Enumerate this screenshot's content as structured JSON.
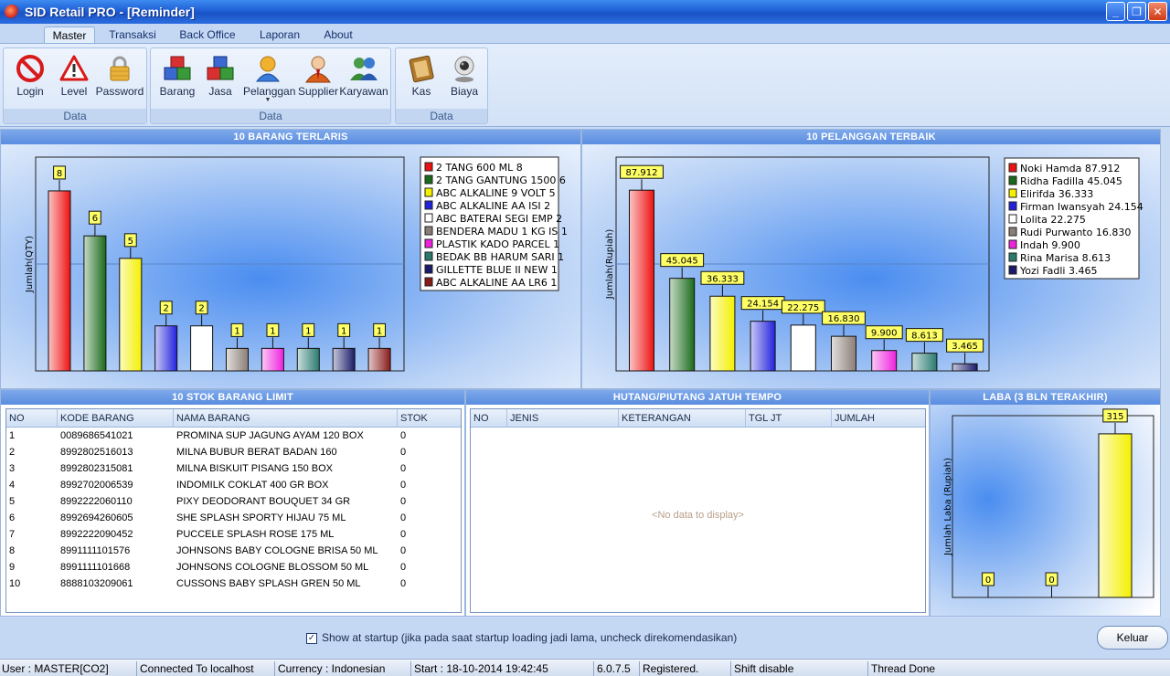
{
  "window": {
    "title": "SID Retail PRO - [Reminder]"
  },
  "ribbon": {
    "tabs": [
      "Master",
      "Transaksi",
      "Back Office",
      "Laporan",
      "About"
    ],
    "active_tab": "Master",
    "groups": [
      {
        "label": "Data",
        "buttons": [
          {
            "label": "Login",
            "icon": "no-entry-icon"
          },
          {
            "label": "Level",
            "icon": "warning-icon"
          },
          {
            "label": "Password",
            "icon": "padlock-icon"
          }
        ]
      },
      {
        "label": "Data",
        "buttons": [
          {
            "label": "Barang",
            "icon": "boxes-icon"
          },
          {
            "label": "Jasa",
            "icon": "boxes-icon"
          },
          {
            "label": "Pelanggan",
            "icon": "customer-icon",
            "dropdown": true
          },
          {
            "label": "Supplier",
            "icon": "supplier-icon"
          },
          {
            "label": "Karyawan",
            "icon": "employees-icon"
          }
        ]
      },
      {
        "label": "Data",
        "buttons": [
          {
            "label": "Kas",
            "icon": "cash-book-icon"
          },
          {
            "label": "Biaya",
            "icon": "webcam-icon"
          }
        ]
      }
    ]
  },
  "panels": {
    "top_selling": {
      "title": "10 BARANG TERLARIS"
    },
    "top_customers": {
      "title": "10 PELANGGAN TERBAIK"
    },
    "stock_limit": {
      "title": "10 STOK BARANG LIMIT"
    },
    "due_debts": {
      "title": "HUTANG/PIUTANG JATUH TEMPO"
    },
    "profit": {
      "title": "LABA (3 BLN TERAKHIR)"
    }
  },
  "chart_data": [
    {
      "type": "bar",
      "ylabel": "Jumlah(QTY)",
      "ylim": [
        0,
        9.5
      ],
      "categories": [
        "2 TANG 600 ML",
        "2 TANG GANTUNG 1500",
        "ABC ALKALINE 9 VOLT",
        "ABC ALKALINE AA ISI 2",
        "ABC BATERAI SEGI EMP",
        "BENDERA MADU 1 KG IS",
        "PLASTIK KADO PARCEL",
        "BEDAK BB HARUM SARI",
        "GILLETTE BLUE II NEW",
        "ABC ALKALINE AA LR6"
      ],
      "values": [
        8,
        6,
        5,
        2,
        2,
        1,
        1,
        1,
        1,
        1
      ],
      "labels": [
        "8",
        "6",
        "5",
        "2",
        "2",
        "1",
        "1",
        "1",
        "1",
        "1"
      ],
      "legend": [
        "2 TANG 600 ML 8",
        "2 TANG GANTUNG 1500  6",
        "ABC ALKALINE 9 VOLT 5",
        "ABC ALKALINE AA ISI  2",
        "ABC BATERAI SEGI EMP 2",
        "BENDERA MADU 1 KG IS 1",
        "PLASTIK KADO PARCEL 1",
        "BEDAK BB HARUM SARI  1",
        "GILLETTE BLUE II NEW 1",
        "ABC ALKALINE AA LR6  1"
      ],
      "colors": [
        "#ee1111",
        "#1a6a1a",
        "#f4f000",
        "#2222dd",
        "#ffffff",
        "#8a7d76",
        "#ee22dd",
        "#2a7a70",
        "#1a1a6a",
        "#8a1a1a"
      ],
      "legend_position": "top-right"
    },
    {
      "type": "bar",
      "ylabel": "Jumlah(Rupiah)",
      "ylim": [
        0,
        104
      ],
      "categories": [
        "Noki Hamda",
        "Ridha Fadilla",
        "Elirifda",
        "Firman Iwansyah",
        "Lolita",
        "Rudi Purwanto",
        "Indah",
        "Rina Marisa",
        "Yozi Fadli"
      ],
      "values": [
        87.912,
        45.045,
        36.333,
        24.154,
        22.275,
        16.83,
        9.9,
        8.613,
        3.465
      ],
      "labels": [
        "87.912",
        "45.045",
        "36.333",
        "24.154",
        "22.275",
        "16.830",
        "9.900",
        "8.613",
        "3.465"
      ],
      "legend": [
        "Noki Hamda 87.912",
        "Ridha Fadilla 45.045",
        "Elirifda 36.333",
        "Firman Iwansyah 24.154",
        "Lolita 22.275",
        "Rudi Purwanto 16.830",
        "Indah 9.900",
        "Rina Marisa 8.613",
        "Yozi Fadli 3.465"
      ],
      "colors": [
        "#ee1111",
        "#1a6a1a",
        "#f4f000",
        "#2222dd",
        "#ffffff",
        "#8a7d76",
        "#ee22dd",
        "#2a7a70",
        "#1a1a6a"
      ],
      "legend_position": "top-right"
    },
    {
      "type": "bar",
      "ylabel": "Jumlah Laba (Rupiah)",
      "ylim": [
        0,
        350
      ],
      "values": [
        0,
        0,
        315
      ],
      "labels": [
        "0",
        "0",
        "315"
      ],
      "colors": [
        "#f4f000",
        "#f4f000",
        "#f4f000"
      ]
    }
  ],
  "stock_table": {
    "columns": [
      "NO",
      "KODE BARANG",
      "NAMA BARANG",
      "STOK"
    ],
    "rows": [
      [
        "1",
        "0089686541021",
        "PROMINA SUP JAGUNG AYAM 120 BOX",
        "0"
      ],
      [
        "2",
        "8992802516013",
        "MILNA BUBUR BERAT BADAN 160",
        "0"
      ],
      [
        "3",
        "8992802315081",
        "MILNA BISKUIT PISANG 150 BOX",
        "0"
      ],
      [
        "4",
        "8992702006539",
        "INDOMILK COKLAT 400 GR BOX",
        "0"
      ],
      [
        "5",
        "8992222060110",
        "PIXY DEODORANT BOUQUET 34 GR",
        "0"
      ],
      [
        "6",
        "8992694260605",
        "SHE SPLASH SPORTY HIJAU 75 ML",
        "0"
      ],
      [
        "7",
        "8992222090452",
        "PUCCELE SPLASH ROSE 175 ML",
        "0"
      ],
      [
        "8",
        "8991111101576",
        "JOHNSONS BABY COLOGNE BRISA 50 ML",
        "0"
      ],
      [
        "9",
        "8991111101668",
        "JOHNSONS COLOGNE BLOSSOM 50 ML",
        "0"
      ],
      [
        "10",
        "8888103209061",
        "CUSSONS BABY SPLASH GREN 50 ML",
        "0"
      ]
    ]
  },
  "debt_table": {
    "columns": [
      "NO",
      "JENIS",
      "KETERANGAN",
      "TGL JT",
      "JUMLAH"
    ],
    "empty_text": "<No data to display>"
  },
  "footer": {
    "show_at_startup_checked": true,
    "show_at_startup_label": "Show at startup (jika pada saat startup loading jadi lama, uncheck direkomendasikan)",
    "exit_label": "Keluar"
  },
  "statusbar": [
    "User : MASTER[CO2]",
    "Connected To localhost",
    "Currency : Indonesian",
    "Start  : 18-10-2014 19:42:45",
    "6.0.7.5",
    "Registered.",
    "Shift disable",
    "Thread Done"
  ]
}
